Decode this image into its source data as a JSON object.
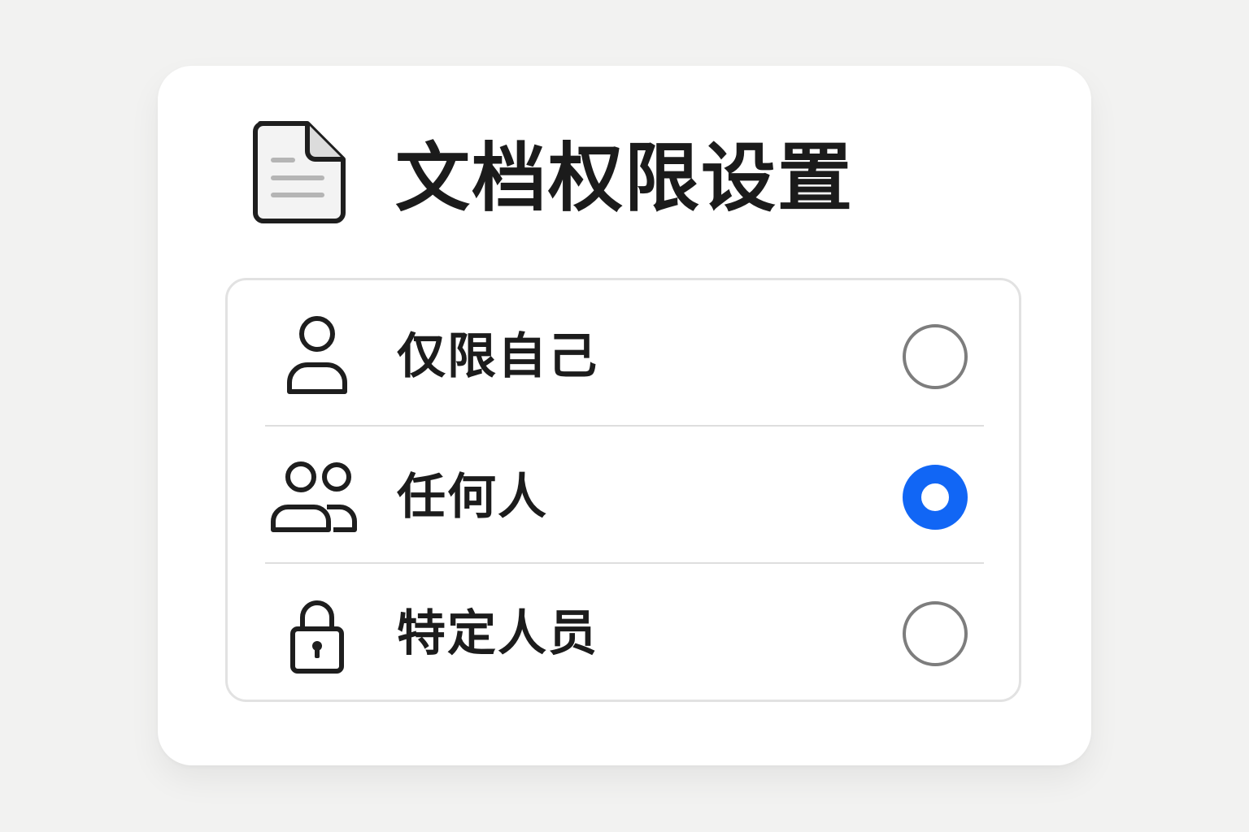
{
  "dialog": {
    "title": "文档权限设置",
    "title_icon": "document-icon"
  },
  "options": [
    {
      "label": "仅限自己",
      "icon": "person-icon",
      "selected": false
    },
    {
      "label": "任何人",
      "icon": "people-icon",
      "selected": true
    },
    {
      "label": "特定人员",
      "icon": "lock-icon",
      "selected": false
    }
  ],
  "colors": {
    "accent": "#1166f5",
    "radio_unselected": "#7d7d7d",
    "background": "#f2f2f1",
    "card": "#ffffff",
    "text": "#1b1b1b"
  }
}
